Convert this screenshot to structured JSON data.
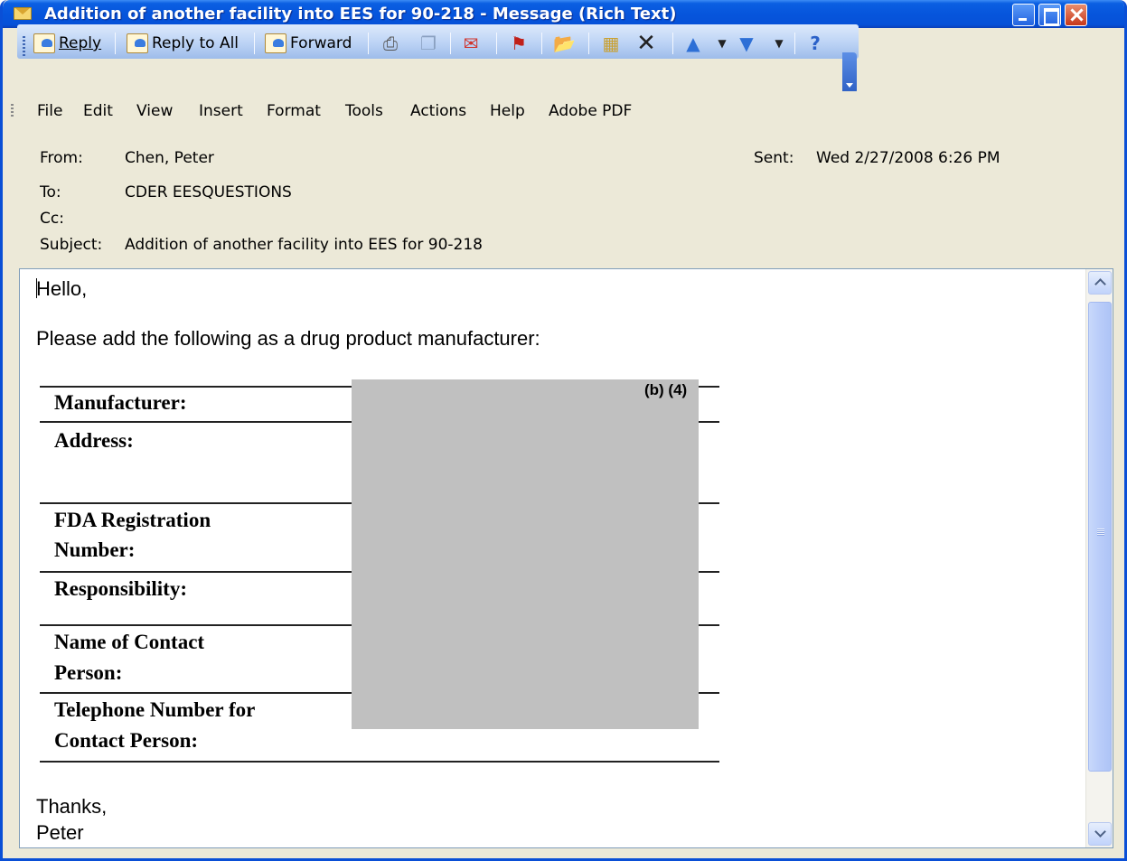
{
  "window": {
    "title": "Addition of another facility into EES for 90-218 - Message (Rich Text)"
  },
  "toolbar": {
    "reply": "Reply",
    "reply_all": "Reply to All",
    "forward": "Forward"
  },
  "menu": [
    "File",
    "Edit",
    "View",
    "Insert",
    "Format",
    "Tools",
    "Actions",
    "Help",
    "Adobe PDF"
  ],
  "header": {
    "from_label": "From:",
    "from_value": "Chen, Peter",
    "sent_label": "Sent:",
    "sent_value": "Wed 2/27/2008 6:26 PM",
    "to_label": "To:",
    "to_value": "CDER EESQUESTIONS",
    "cc_label": "Cc:",
    "subject_label": "Subject:",
    "subject_value": "Addition of another facility into EES for 90-218"
  },
  "body": {
    "greeting": "Hello,",
    "intro": "Please add the following as a drug product manufacturer:",
    "redaction_code": "(b) (4)",
    "table_labels": {
      "manufacturer": "Manufacturer:",
      "address": "Address:",
      "fda_reg_1": "FDA Registration",
      "fda_reg_2": "Number:",
      "responsibility": "Responsibility:",
      "contact_1": "Name of Contact",
      "contact_2": "Person:",
      "phone_1": "Telephone Number for",
      "phone_2": "Contact Person:"
    },
    "closing": "Thanks,",
    "signature": "Peter"
  }
}
